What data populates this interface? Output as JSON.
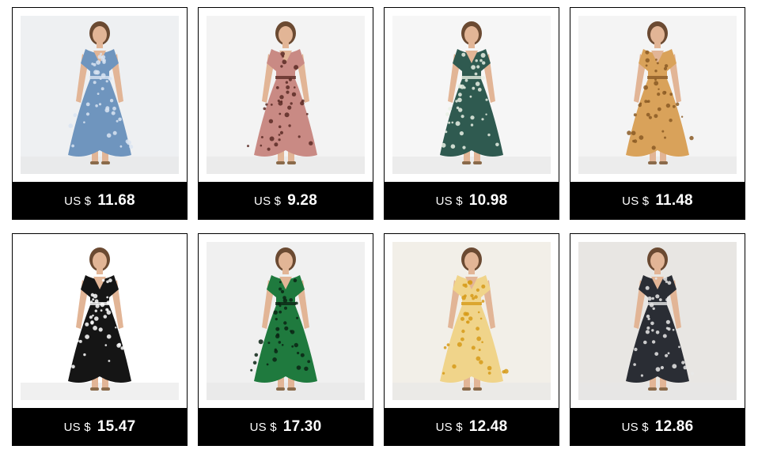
{
  "products": [
    {
      "currency": "US $",
      "price": "11.68",
      "image_icon": "blue-floral-wrap-dress-icon",
      "dress_color": "#6f95be",
      "pattern_color": "#d9e4f2",
      "bg_color": "#eef0f2"
    },
    {
      "currency": "US $",
      "price": "9.28",
      "image_icon": "pink-leopard-wrap-dress-icon",
      "dress_color": "#c98a84",
      "pattern_color": "#5b2a25",
      "bg_color": "#f3f3f3"
    },
    {
      "currency": "US $",
      "price": "10.98",
      "image_icon": "green-daisy-wrap-dress-icon",
      "dress_color": "#2f5a50",
      "pattern_color": "#e8f0e4",
      "bg_color": "#f6f6f6"
    },
    {
      "currency": "US $",
      "price": "11.48",
      "image_icon": "mustard-polka-dot-dress-icon",
      "dress_color": "#d9a25a",
      "pattern_color": "#8a5a25",
      "bg_color": "#f4f4f4"
    },
    {
      "currency": "US $",
      "price": "15.47",
      "image_icon": "black-polka-dot-dress-icon",
      "dress_color": "#151515",
      "pattern_color": "#ffffff",
      "bg_color": "#ffffff"
    },
    {
      "currency": "US $",
      "price": "17.30",
      "image_icon": "green-tropical-leaf-dress-icon",
      "dress_color": "#1f7a3e",
      "pattern_color": "#0b2414",
      "bg_color": "#f0f0f0"
    },
    {
      "currency": "US $",
      "price": "12.48",
      "image_icon": "yellow-floral-wrap-dress-icon",
      "dress_color": "#f0d48a",
      "pattern_color": "#d69a18",
      "bg_color": "#f2efe8"
    },
    {
      "currency": "US $",
      "price": "12.86",
      "image_icon": "black-leopard-long-sleeve-dress-icon",
      "dress_color": "#2a2d34",
      "pattern_color": "#e8e8e8",
      "bg_color": "#e8e6e3"
    }
  ]
}
